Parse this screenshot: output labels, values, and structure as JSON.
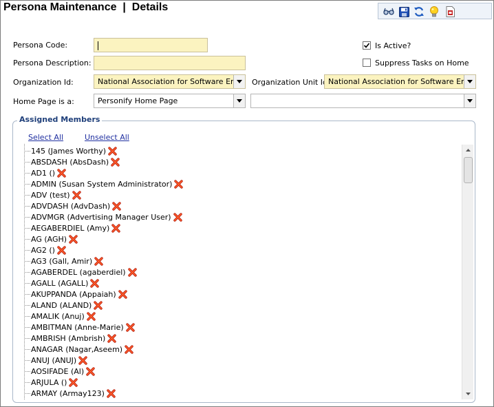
{
  "header": {
    "title": "Persona Maintenance",
    "separator": "|",
    "subtitle": "Details"
  },
  "toolbar": {
    "buttons": [
      {
        "name": "glasses-icon"
      },
      {
        "name": "save-icon"
      },
      {
        "name": "refresh-icon"
      },
      {
        "name": "lightbulb-icon"
      },
      {
        "name": "report-icon"
      }
    ]
  },
  "form": {
    "persona_code_label": "Persona Code:",
    "persona_code_value": "",
    "persona_description_label": "Persona Description:",
    "persona_description_value": "",
    "organization_id_label": "Organization Id:",
    "organization_id_value": "National Association for Software Engineers",
    "organization_unit_id_label": "Organization Unit Id:",
    "organization_unit_id_value": "National Association for Software Engineers",
    "home_page_label": "Home Page is a:",
    "home_page_value": "Personify Home Page",
    "home_page_detail_value": "",
    "is_active_label": "Is Active?",
    "is_active_checked": true,
    "suppress_tasks_label": "Suppress Tasks on Home",
    "suppress_tasks_checked": false
  },
  "assigned_members": {
    "legend": "Assigned Members",
    "select_all": "Select All",
    "unselect_all": "Unselect All",
    "members": [
      "145 (James Worthy)",
      "ABSDASH (AbsDash)",
      "AD1 ()",
      "ADMIN (Susan System Administrator)",
      "ADV (test)",
      "ADVDASH (AdvDash)",
      "ADVMGR (Advertising Manager User)",
      "AEGABERDIEL (Amy)",
      "AG (AGH)",
      "AG2 ()",
      "AG3 (Gall, Amir)",
      "AGABERDEL (agaberdiel)",
      "AGALL (AGALL)",
      "AKUPPANDA (Appaiah)",
      "ALAND (ALAND)",
      "AMALIK (Anuj)",
      "AMBITMAN (Anne-Marie)",
      "AMBRISH (Ambrish)",
      "ANAGAR (Nagar,Aseem)",
      "ANUJ (ANUJ)",
      "AOSIFADE (Al)",
      "ARJULA ()",
      "ARMAY (Armay123)"
    ]
  }
}
